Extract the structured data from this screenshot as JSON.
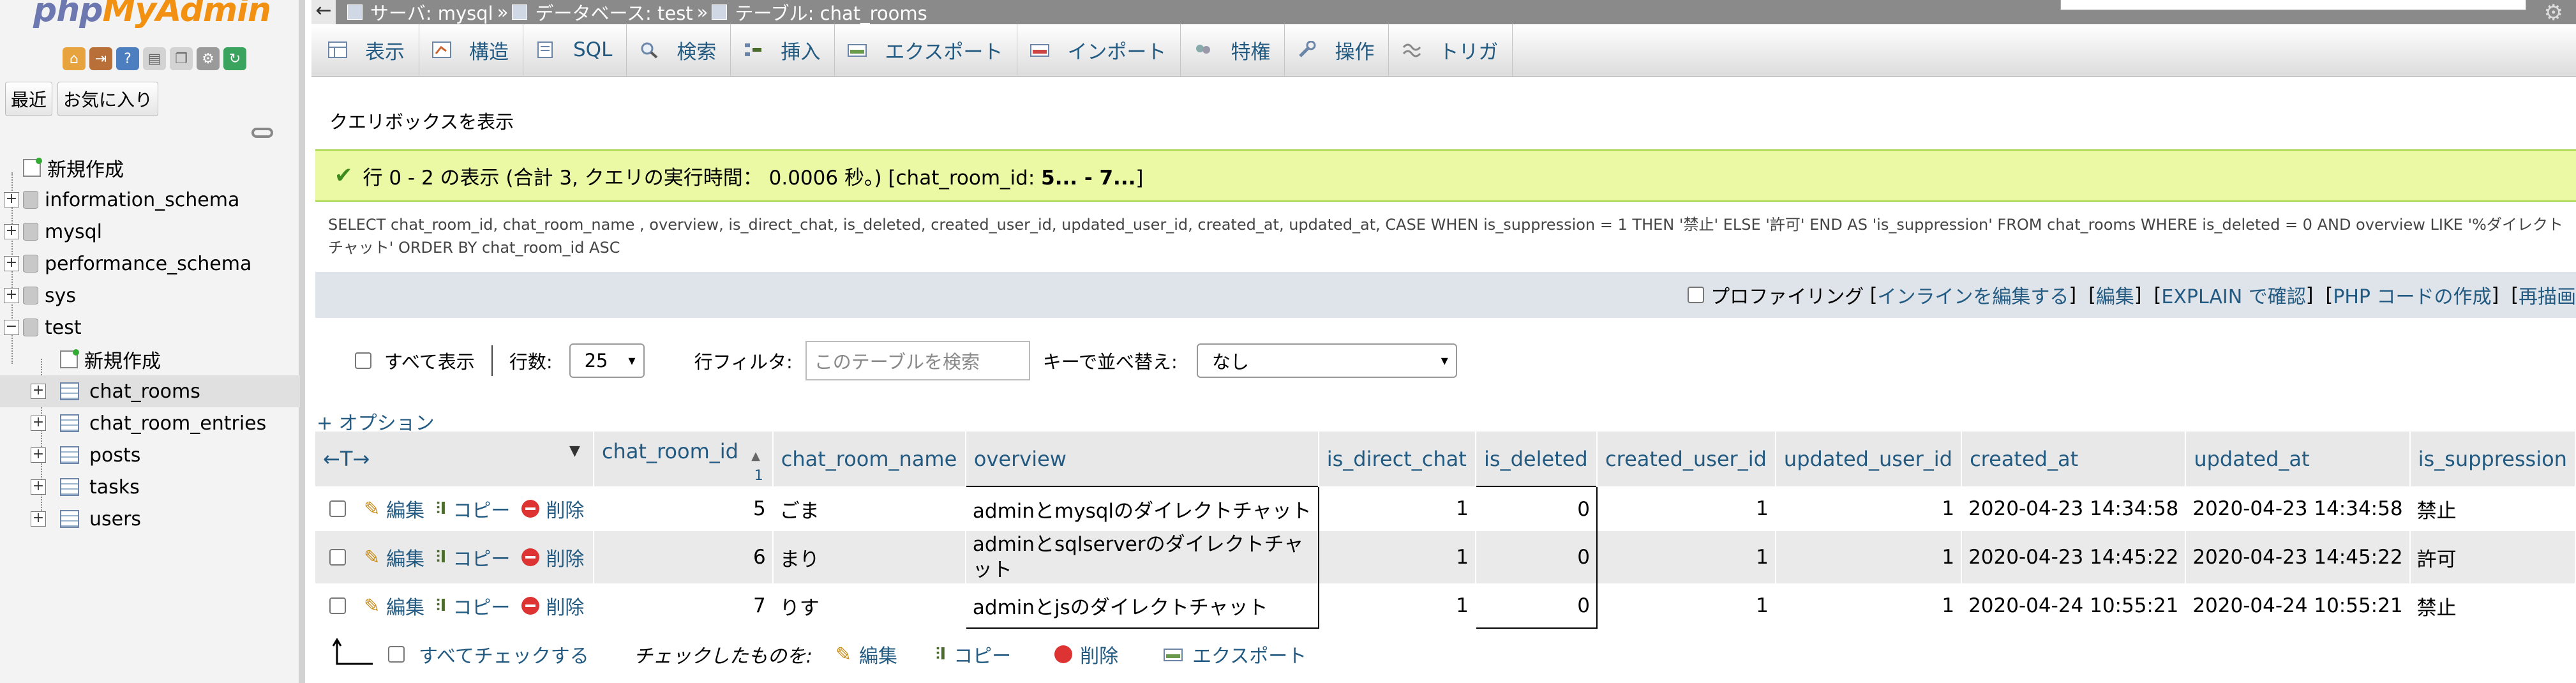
{
  "app": {
    "logo_php": "php",
    "logo_myadmin": "MyAdmin"
  },
  "nav": {
    "tabs": [
      "最近",
      "お気に入り"
    ],
    "tree": [
      {
        "label": "新規作成",
        "type": "new",
        "level": 0
      },
      {
        "label": "information_schema",
        "type": "db",
        "level": 0
      },
      {
        "label": "mysql",
        "type": "db",
        "level": 0
      },
      {
        "label": "performance_schema",
        "type": "db",
        "level": 0
      },
      {
        "label": "sys",
        "type": "db",
        "level": 0
      },
      {
        "label": "test",
        "type": "db",
        "level": 0,
        "expanded": true
      },
      {
        "label": "新規作成",
        "type": "new",
        "level": 1
      },
      {
        "label": "chat_rooms",
        "type": "table",
        "level": 1,
        "selected": true
      },
      {
        "label": "chat_room_entries",
        "type": "table",
        "level": 1
      },
      {
        "label": "posts",
        "type": "table",
        "level": 1
      },
      {
        "label": "tasks",
        "type": "table",
        "level": 1
      },
      {
        "label": "users",
        "type": "table",
        "level": 1
      }
    ]
  },
  "breadcrumb": {
    "server": "サーバ: mysql",
    "database": "データベース: test",
    "table": "テーブル: chat_rooms",
    "separator": "»"
  },
  "menu": [
    {
      "label": "表示",
      "icon": "browse-icon"
    },
    {
      "label": "構造",
      "icon": "structure-icon"
    },
    {
      "label": "SQL",
      "icon": "sql-icon"
    },
    {
      "label": "検索",
      "icon": "search-icon"
    },
    {
      "label": "挿入",
      "icon": "insert-icon"
    },
    {
      "label": "エクスポート",
      "icon": "export-icon"
    },
    {
      "label": "インポート",
      "icon": "import-icon"
    },
    {
      "label": "特権",
      "icon": "privileges-icon"
    },
    {
      "label": "操作",
      "icon": "operations-icon"
    },
    {
      "label": "トリガ",
      "icon": "triggers-icon"
    }
  ],
  "query_toggle": "クエリボックスを表示",
  "result": {
    "message_start": "行 0 - 2 の表示 (合計 3, クエリの実行時間： 0.0006 秒。) [chat_room_id: ",
    "message_range": "5... - 7...",
    "message_end": "]"
  },
  "sql": {
    "text": "SELECT chat_room_id, chat_room_name , overview, is_direct_chat, is_deleted, created_user_id, updated_user_id, created_at, updated_at, CASE WHEN is_suppression = 1 THEN '禁止' ELSE '許可' END AS 'is_suppression' FROM chat_rooms WHERE is_deleted = 0 AND overview LIKE '%ダイレクトチャット' ORDER BY chat_room_id ASC"
  },
  "sql_links": {
    "profiling": "プロファイリング",
    "inline_edit": "インラインを編集する",
    "edit": "編集",
    "explain": "EXPLAIN で確認",
    "php_code": "PHP コードの作成",
    "refresh": "再描画"
  },
  "filters": {
    "show_all": "すべて表示",
    "rows_label": "行数:",
    "rows_value": "25",
    "row_filter_label": "行フィルタ:",
    "row_filter_placeholder": "このテーブルを検索",
    "sort_label": "キーで並べ替え:",
    "sort_value": "なし"
  },
  "options_link": "+ オプション",
  "table": {
    "arrows": "←T→",
    "sort_number": "1",
    "columns": [
      "chat_room_id",
      "chat_room_name",
      "overview",
      "is_direct_chat",
      "is_deleted",
      "created_user_id",
      "updated_user_id",
      "created_at",
      "updated_at",
      "is_suppression"
    ],
    "actions": {
      "edit": "編集",
      "copy": "コピー",
      "delete": "削除"
    },
    "rows": [
      {
        "chat_room_id": "5",
        "chat_room_name": "ごま",
        "overview": "adminとmysqlのダイレクトチャット",
        "is_direct_chat": "1",
        "is_deleted": "0",
        "created_user_id": "1",
        "updated_user_id": "1",
        "created_at": "2020-04-23 14:34:58",
        "updated_at": "2020-04-23 14:34:58",
        "is_suppression": "禁止"
      },
      {
        "chat_room_id": "6",
        "chat_room_name": "まり",
        "overview": "adminとsqlserverのダイレクトチャット",
        "is_direct_chat": "1",
        "is_deleted": "0",
        "created_user_id": "1",
        "updated_user_id": "1",
        "created_at": "2020-04-23 14:45:22",
        "updated_at": "2020-04-23 14:45:22",
        "is_suppression": "許可"
      },
      {
        "chat_room_id": "7",
        "chat_room_name": "りす",
        "overview": "adminとjsのダイレクトチャット",
        "is_direct_chat": "1",
        "is_deleted": "0",
        "created_user_id": "1",
        "updated_user_id": "1",
        "created_at": "2020-04-24 10:55:21",
        "updated_at": "2020-04-24 10:55:21",
        "is_suppression": "禁止"
      }
    ]
  },
  "bottom": {
    "check_all": "すべてチェックする",
    "with_selected": "チェックしたものを:",
    "edit": "編集",
    "copy": "コピー",
    "delete": "削除",
    "export": "エクスポート"
  }
}
